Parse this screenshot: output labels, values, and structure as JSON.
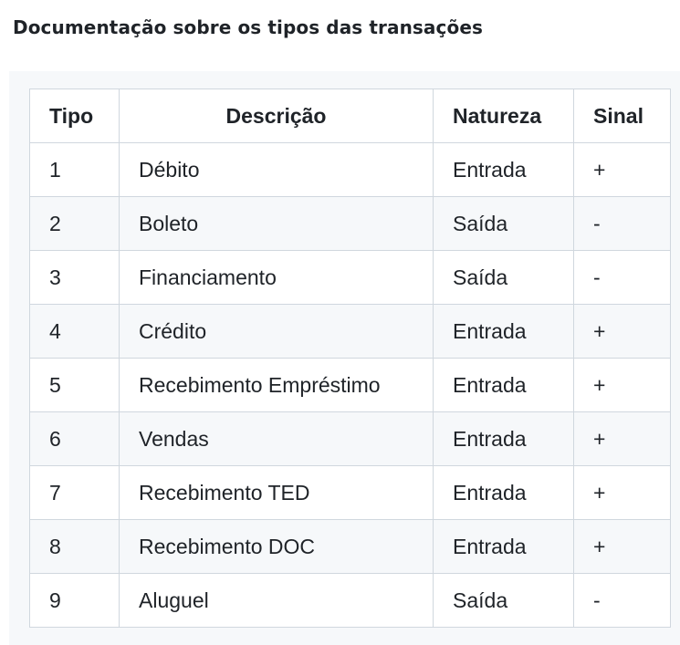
{
  "title": "Documentação sobre os tipos das transações",
  "table": {
    "headers": {
      "tipo": "Tipo",
      "descricao": "Descrição",
      "natureza": "Natureza",
      "sinal": "Sinal"
    },
    "rows": [
      {
        "tipo": "1",
        "descricao": "Débito",
        "natureza": "Entrada",
        "sinal": "+"
      },
      {
        "tipo": "2",
        "descricao": "Boleto",
        "natureza": "Saída",
        "sinal": "-"
      },
      {
        "tipo": "3",
        "descricao": "Financiamento",
        "natureza": "Saída",
        "sinal": "-"
      },
      {
        "tipo": "4",
        "descricao": "Crédito",
        "natureza": "Entrada",
        "sinal": "+"
      },
      {
        "tipo": "5",
        "descricao": "Recebimento Empréstimo",
        "natureza": "Entrada",
        "sinal": "+"
      },
      {
        "tipo": "6",
        "descricao": "Vendas",
        "natureza": "Entrada",
        "sinal": "+"
      },
      {
        "tipo": "7",
        "descricao": "Recebimento TED",
        "natureza": "Entrada",
        "sinal": "+"
      },
      {
        "tipo": "8",
        "descricao": "Recebimento DOC",
        "natureza": "Entrada",
        "sinal": "+"
      },
      {
        "tipo": "9",
        "descricao": "Aluguel",
        "natureza": "Saída",
        "sinal": "-"
      }
    ]
  },
  "colors": {
    "text": "#1f2328",
    "border": "#d0d7de",
    "stripe": "#f6f8fa",
    "background": "#ffffff"
  }
}
